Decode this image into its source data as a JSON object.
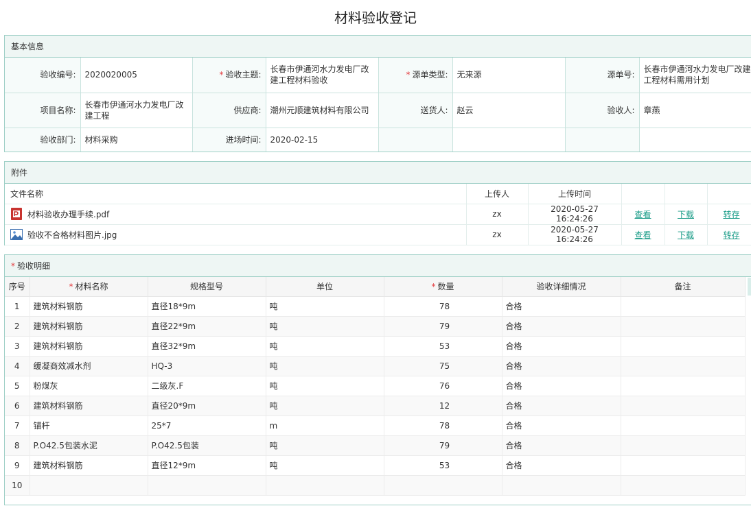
{
  "page": {
    "title": "材料验收登记"
  },
  "basic_info": {
    "header": "基本信息",
    "fields": {
      "acceptance_no": {
        "label": "验收编号:",
        "value": "2020020005"
      },
      "subject": {
        "label": "验收主题:",
        "value": "长春市伊通河水力发电厂改建工程材料验收",
        "required": true
      },
      "source_type": {
        "label": "源单类型:",
        "value": "无来源",
        "required": true
      },
      "source_no": {
        "label": "源单号:",
        "value": "长春市伊通河水力发电厂改建工程材料需用计划"
      },
      "project_name": {
        "label": "项目名称:",
        "value": "长春市伊通河水力发电厂改建工程"
      },
      "supplier": {
        "label": "供应商:",
        "value": "潮州元顺建筑材料有限公司"
      },
      "deliverer": {
        "label": "送货人:",
        "value": "赵云"
      },
      "receiver": {
        "label": "验收人:",
        "value": "章燕"
      },
      "department": {
        "label": "验收部门:",
        "value": "材料采购"
      },
      "entry_time": {
        "label": "进场时间:",
        "value": "2020-02-15"
      }
    }
  },
  "attachments": {
    "header": "附件",
    "columns": {
      "name": "文件名称",
      "uploader": "上传人",
      "time": "上传时间"
    },
    "files": [
      {
        "name": "材料验收办理手续.pdf",
        "icon": "pdf-icon",
        "uploader": "zx",
        "time": "2020-05-27 16:24:26",
        "view": "查看",
        "download": "下载",
        "transfer": "转存"
      },
      {
        "name": "验收不合格材料图片.jpg",
        "icon": "image-icon",
        "uploader": "zx",
        "time": "2020-05-27 16:24:26",
        "view": "查看",
        "download": "下载",
        "transfer": "转存"
      }
    ]
  },
  "details": {
    "header": "验收明细",
    "columns": {
      "index": "序号",
      "material": "材料名称",
      "spec": "规格型号",
      "unit": "单位",
      "qty": "数量",
      "detail": "验收详细情况",
      "remark": "备注"
    },
    "rows": [
      {
        "index": "1",
        "material": "建筑材料钢筋",
        "spec": "直径18*9m",
        "unit": "吨",
        "qty": "78",
        "detail": "合格",
        "remark": ""
      },
      {
        "index": "2",
        "material": "建筑材料钢筋",
        "spec": "直径22*9m",
        "unit": "吨",
        "qty": "79",
        "detail": "合格",
        "remark": ""
      },
      {
        "index": "3",
        "material": "建筑材料钢筋",
        "spec": "直径32*9m",
        "unit": "吨",
        "qty": "53",
        "detail": "合格",
        "remark": ""
      },
      {
        "index": "4",
        "material": "缓凝商效减水剂",
        "spec": "HQ-3",
        "unit": "吨",
        "qty": "75",
        "detail": "合格",
        "remark": ""
      },
      {
        "index": "5",
        "material": "粉煤灰",
        "spec": "二级灰.F",
        "unit": "吨",
        "qty": "76",
        "detail": "合格",
        "remark": ""
      },
      {
        "index": "6",
        "material": "建筑材料钢筋",
        "spec": "直径20*9m",
        "unit": "吨",
        "qty": "12",
        "detail": "合格",
        "remark": ""
      },
      {
        "index": "7",
        "material": "锚杆",
        "spec": "25*7",
        "unit": "m",
        "qty": "78",
        "detail": "合格",
        "remark": ""
      },
      {
        "index": "8",
        "material": "P.O42.5包装水泥",
        "spec": "P.O42.5包装",
        "unit": "吨",
        "qty": "79",
        "detail": "合格",
        "remark": ""
      },
      {
        "index": "9",
        "material": "建筑材料钢筋",
        "spec": "直径12*9m",
        "unit": "吨",
        "qty": "53",
        "detail": "合格",
        "remark": ""
      },
      {
        "index": "10",
        "material": "",
        "spec": "",
        "unit": "",
        "qty": "",
        "detail": "",
        "remark": ""
      }
    ]
  },
  "colors": {
    "accent": "#1a9c88",
    "border": "#9ecfc6",
    "header_bg": "#eef6f4",
    "required": "#e4393c"
  }
}
